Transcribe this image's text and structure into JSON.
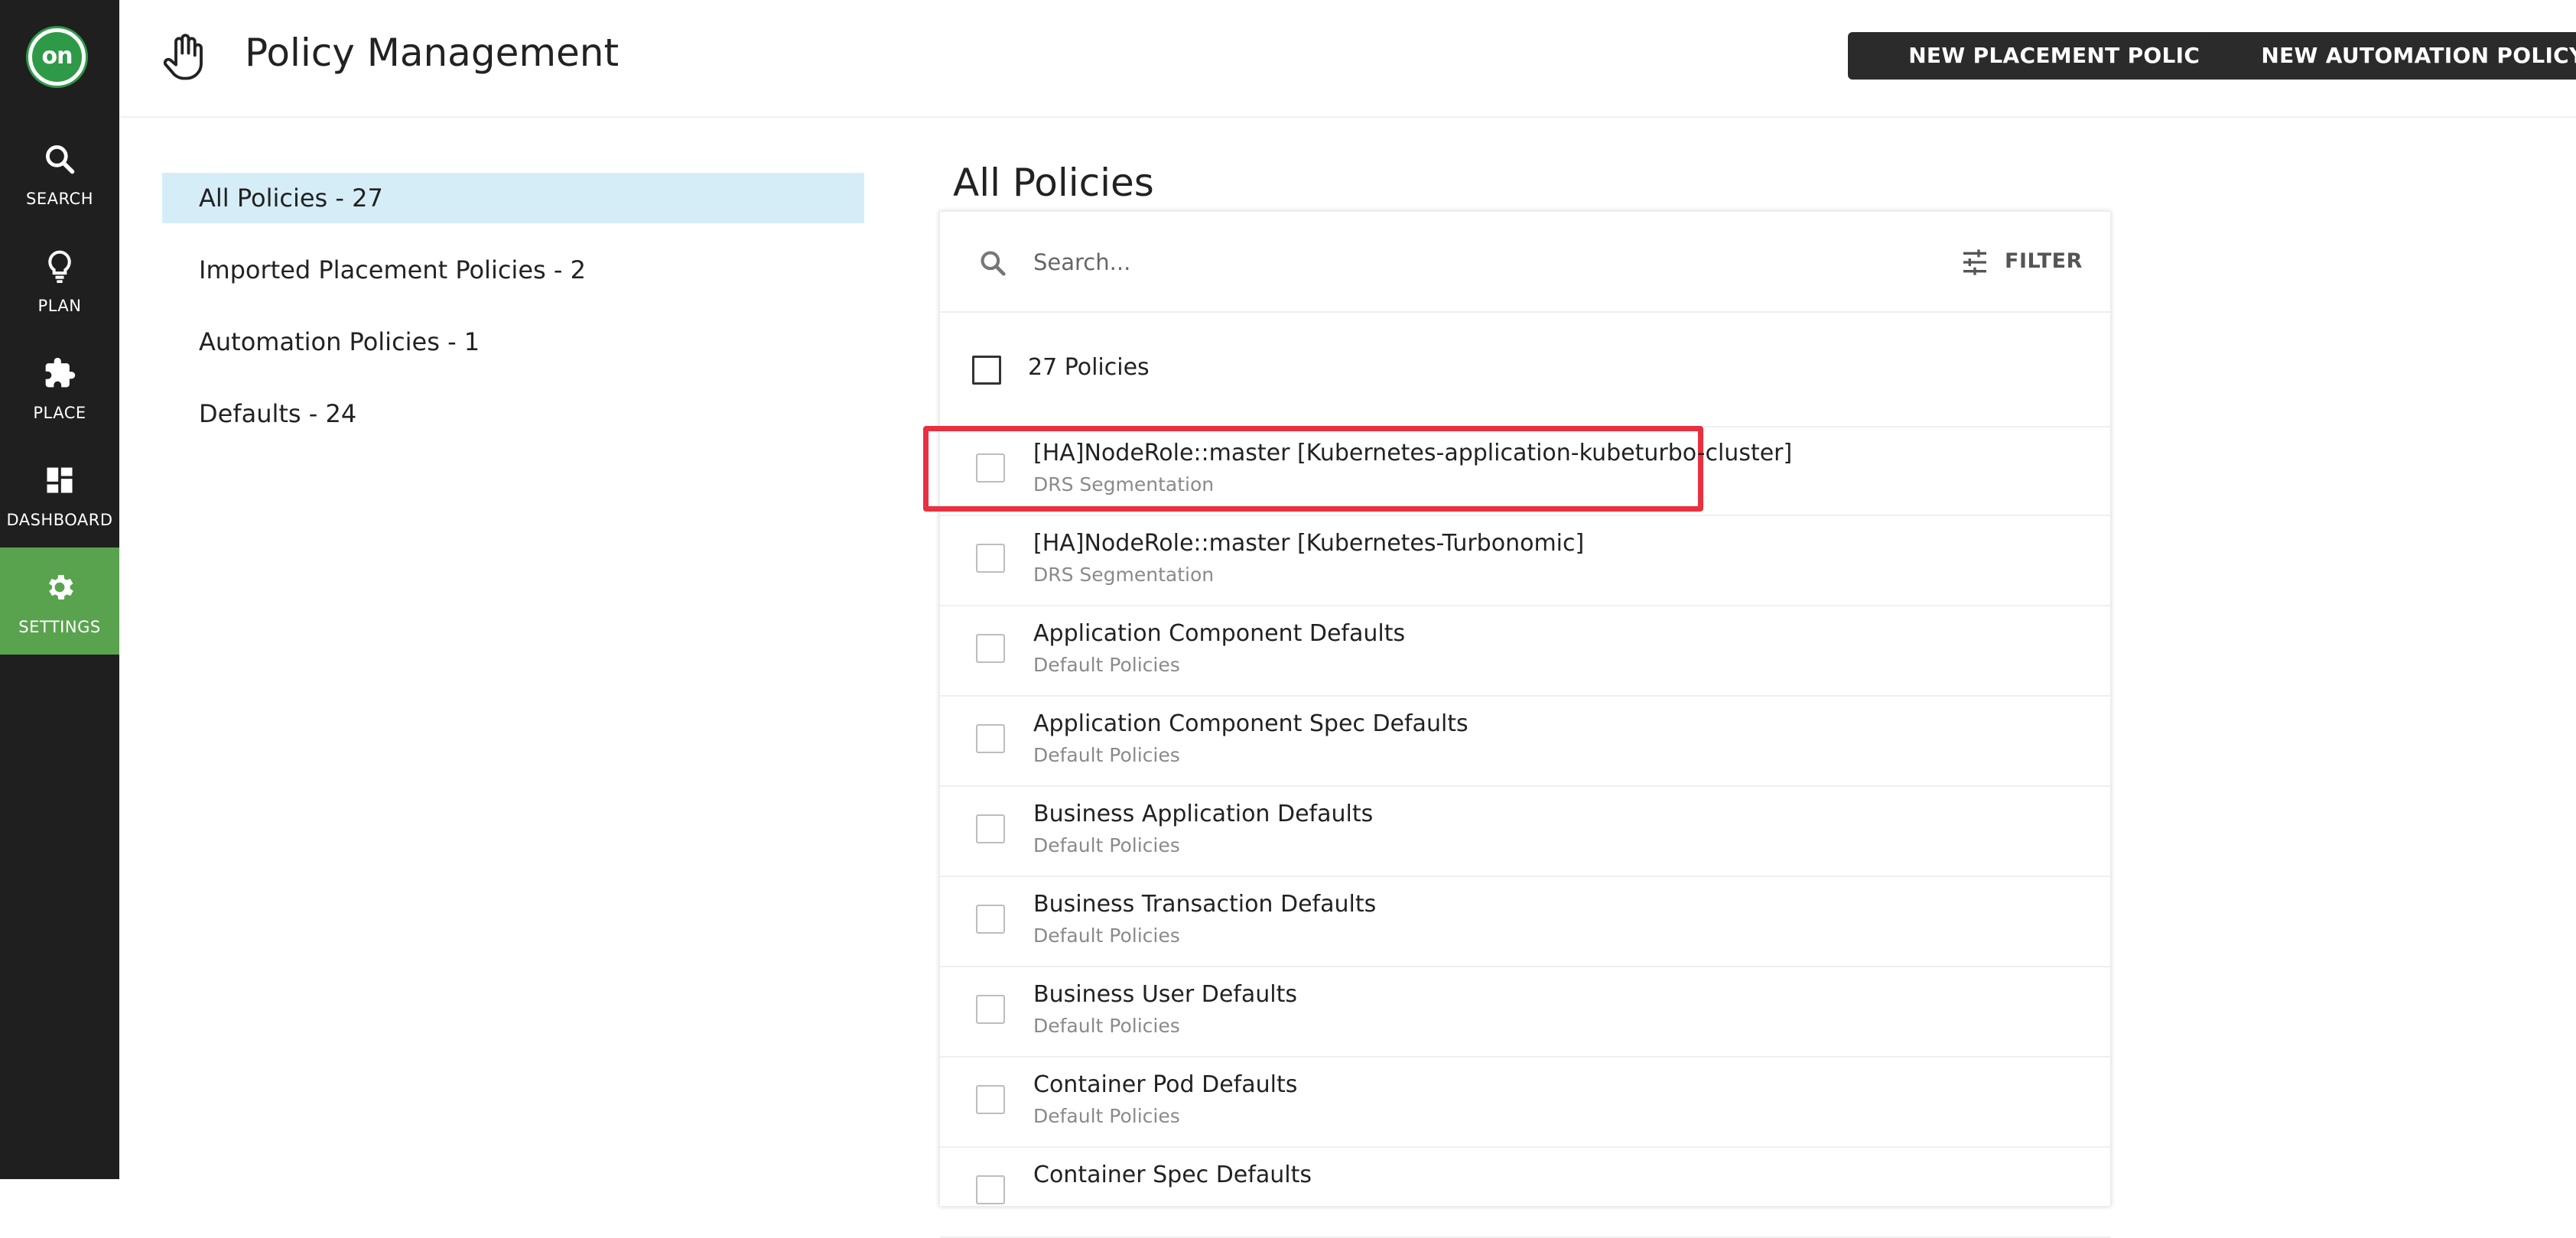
{
  "rail": {
    "logo_text": "on",
    "items": [
      {
        "label": "SEARCH",
        "icon": "search-icon"
      },
      {
        "label": "PLAN",
        "icon": "lightbulb-icon"
      },
      {
        "label": "PLACE",
        "icon": "puzzle-icon"
      },
      {
        "label": "DASHBOARD",
        "icon": "dashboard-icon"
      },
      {
        "label": "SETTINGS",
        "icon": "gear-icon",
        "active": true
      }
    ]
  },
  "header": {
    "title": "Policy Management",
    "icon": "hand-icon",
    "new_placement_label": "NEW PLACEMENT POLICY",
    "new_automation_label": "NEW AUTOMATION POLICY"
  },
  "categories": [
    {
      "label": "All Policies - 27",
      "active": true
    },
    {
      "label": "Imported Placement Policies - 2"
    },
    {
      "label": "Automation Policies - 1"
    },
    {
      "label": "Defaults - 24"
    }
  ],
  "main": {
    "title": "All Policies",
    "search_placeholder": "Search...",
    "filter_label": "FILTER",
    "count_label": "27 Policies",
    "policies": [
      {
        "name": "[HA]NodeRole::master [Kubernetes-application-kubeturbo-cluster]",
        "type": "DRS Segmentation",
        "highlighted": true
      },
      {
        "name": "[HA]NodeRole::master [Kubernetes-Turbonomic]",
        "type": "DRS Segmentation"
      },
      {
        "name": "Application Component Defaults",
        "type": "Default Policies"
      },
      {
        "name": "Application Component Spec Defaults",
        "type": "Default Policies"
      },
      {
        "name": "Business Application Defaults",
        "type": "Default Policies"
      },
      {
        "name": "Business Transaction Defaults",
        "type": "Default Policies"
      },
      {
        "name": "Business User Defaults",
        "type": "Default Policies"
      },
      {
        "name": "Container Pod Defaults",
        "type": "Default Policies"
      },
      {
        "name": "Container Spec Defaults",
        "type": ""
      }
    ]
  },
  "colors": {
    "rail_bg": "#1f1f1f",
    "active_nav": "#5aa34e",
    "logo": "#2e9a47",
    "selected_category": "#d5edf6",
    "button_bg": "#2b2b2b",
    "highlight_border": "#e8303f"
  }
}
